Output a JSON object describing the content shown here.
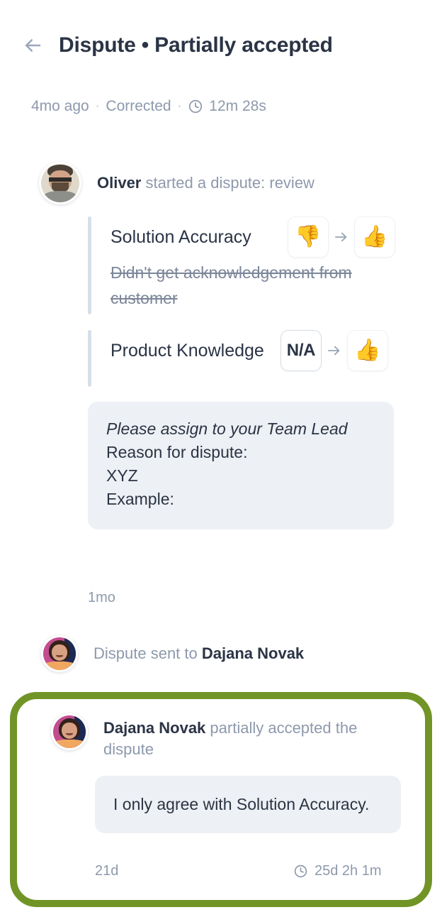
{
  "header": {
    "back_icon": "arrow-left-icon",
    "title": "Dispute • Partially accepted"
  },
  "meta": {
    "age": "4mo ago",
    "separator": "·",
    "status": "Corrected",
    "clock_icon": "clock-icon",
    "duration": "12m 28s"
  },
  "events": [
    {
      "avatar": "oliver-avatar",
      "who": "Oliver",
      "action": " started a dispute: review"
    },
    {
      "avatar": "dajana-avatar",
      "prefix": "Dispute sent to ",
      "who": "Dajana Novak"
    }
  ],
  "ratings": [
    {
      "name": "Solution Accuracy",
      "from": "👎",
      "from_label": "thumbs-down",
      "arrow": "→",
      "to": "👍",
      "to_label": "thumbs-up",
      "comment": "Didn't get acknowledgement from customer"
    },
    {
      "name": "Product Knowledge",
      "from": "N/A",
      "from_label": "not-applicable",
      "arrow": "→",
      "to": "👍",
      "to_label": "thumbs-up",
      "comment": ""
    }
  ],
  "dispute_message": {
    "lines": [
      {
        "text": "Please assign to your Team Lead",
        "italic": true
      },
      {
        "text": "Reason for dispute:",
        "italic": false
      },
      {
        "text": "XYZ",
        "italic": false
      },
      {
        "text": "Example:",
        "italic": false
      }
    ],
    "timestamp": "1mo"
  },
  "highlight": {
    "border_color": "#719426",
    "who": "Dajana Novak",
    "action": " partially accepted the dispute",
    "message": "I only agree with Solution Accuracy.",
    "timestamp": "21d",
    "clock_icon": "clock-icon",
    "duration": "25d 2h 1m"
  },
  "colors": {
    "title": "#2b3445",
    "muted": "#8e99ad",
    "bubble_bg": "#edf0f4",
    "accent_bar": "#d7dfe9",
    "highlight_green": "#719426"
  }
}
